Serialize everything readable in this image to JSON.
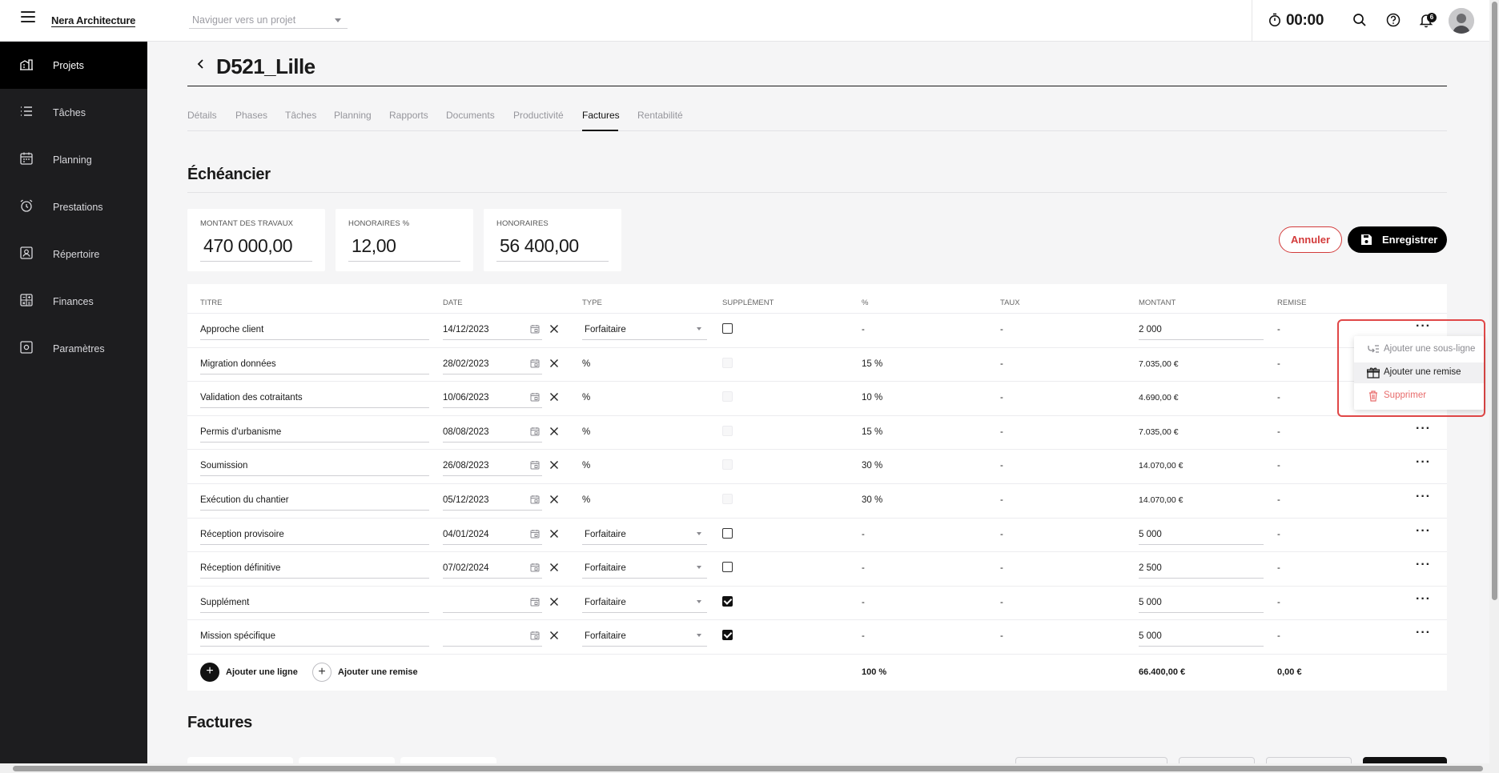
{
  "header": {
    "brand": "Nera Architecture",
    "project_select_placeholder": "Naviguer vers un projet",
    "timer": "00:00",
    "notification_count": "6"
  },
  "sidebar": {
    "items": [
      {
        "label": "Projets",
        "icon": "building-icon",
        "active": true
      },
      {
        "label": "Tâches",
        "icon": "list-icon"
      },
      {
        "label": "Planning",
        "icon": "calendar-icon"
      },
      {
        "label": "Prestations",
        "icon": "alarm-clock-icon"
      },
      {
        "label": "Répertoire",
        "icon": "contact-card-icon"
      },
      {
        "label": "Finances",
        "icon": "calculator-icon"
      },
      {
        "label": "Paramètres",
        "icon": "settings-box-icon"
      }
    ]
  },
  "page": {
    "title": "D521_Lille",
    "tabs": [
      "Détails",
      "Phases",
      "Tâches",
      "Planning",
      "Rapports",
      "Documents",
      "Productivité",
      "Factures",
      "Rentabilité"
    ],
    "active_tab": "Factures"
  },
  "echeancier": {
    "title": "Échéancier",
    "summary": [
      {
        "label": "MONTANT DES TRAVAUX",
        "value": "470 000,00"
      },
      {
        "label": "HONORAIRES %",
        "value": "12,00"
      },
      {
        "label": "HONORAIRES",
        "value": "56 400,00"
      }
    ],
    "cancel_label": "Annuler",
    "save_label": "Enregistrer",
    "columns": [
      "TITRE",
      "DATE",
      "TYPE",
      "SUPPLÉMENT",
      "%",
      "TAUX",
      "MONTANT",
      "REMISE"
    ],
    "rows": [
      {
        "titre": "Approche client",
        "date": "14/12/2023",
        "type": "Forfaitaire",
        "supplement": "off",
        "pct": "-",
        "taux": "-",
        "montant": "2 000",
        "remise": "-"
      },
      {
        "titre": "Migration données",
        "date": "28/02/2023",
        "type": "%",
        "supplement": "disabled",
        "pct": "15 %",
        "taux": "-",
        "montant": "7.035,00 €",
        "remise": "-"
      },
      {
        "titre": "Validation des cotraitants",
        "date": "10/06/2023",
        "type": "%",
        "supplement": "disabled",
        "pct": "10 %",
        "taux": "-",
        "montant": "4.690,00 €",
        "remise": "-"
      },
      {
        "titre": "Permis d'urbanisme",
        "date": "08/08/2023",
        "type": "%",
        "supplement": "disabled",
        "pct": "15 %",
        "taux": "-",
        "montant": "7.035,00 €",
        "remise": "-"
      },
      {
        "titre": "Soumission",
        "date": "26/08/2023",
        "type": "%",
        "supplement": "disabled",
        "pct": "30 %",
        "taux": "-",
        "montant": "14.070,00 €",
        "remise": "-"
      },
      {
        "titre": "Exécution du chantier",
        "date": "05/12/2023",
        "type": "%",
        "supplement": "disabled",
        "pct": "30 %",
        "taux": "-",
        "montant": "14.070,00 €",
        "remise": "-"
      },
      {
        "titre": "Réception provisoire",
        "date": "04/01/2024",
        "type": "Forfaitaire",
        "supplement": "off",
        "pct": "-",
        "taux": "-",
        "montant": "5 000",
        "remise": "-"
      },
      {
        "titre": "Réception définitive",
        "date": "07/02/2024",
        "type": "Forfaitaire",
        "supplement": "off",
        "pct": "-",
        "taux": "-",
        "montant": "2 500",
        "remise": "-"
      },
      {
        "titre": "Supplément",
        "date": "",
        "type": "Forfaitaire",
        "supplement": "on",
        "pct": "-",
        "taux": "-",
        "montant": "5 000",
        "remise": "-"
      },
      {
        "titre": "Mission spécifique",
        "date": "",
        "type": "Forfaitaire",
        "supplement": "on",
        "pct": "-",
        "taux": "-",
        "montant": "5 000",
        "remise": "-"
      }
    ],
    "add_line_label": "Ajouter une ligne",
    "add_discount_label": "Ajouter une remise",
    "total_pct": "100 %",
    "total_montant": "66.400,00 €",
    "total_remise": "0,00 €"
  },
  "row_menu": {
    "items": [
      {
        "label": "Ajouter une sous-ligne",
        "icon": "sub-line-icon"
      },
      {
        "label": "Ajouter une remise",
        "icon": "gift-icon"
      },
      {
        "label": "Supprimer",
        "icon": "trash-icon"
      }
    ]
  },
  "factures": {
    "title": "Factures"
  }
}
